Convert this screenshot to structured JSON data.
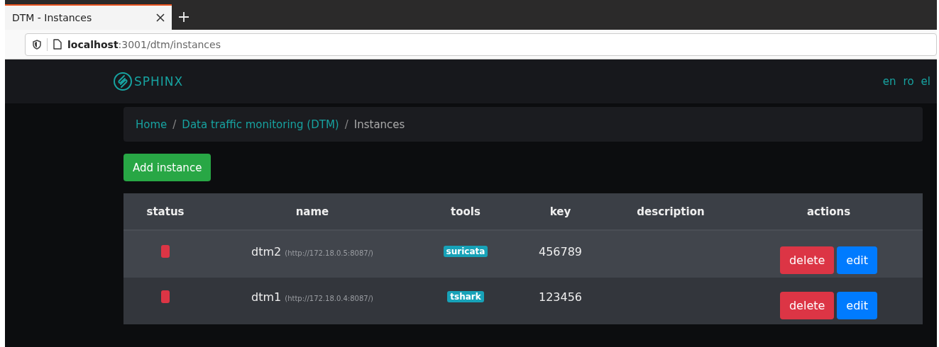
{
  "browser": {
    "tab_title": "DTM - Instances",
    "url_host": "localhost",
    "url_path": ":3001/dtm/instances"
  },
  "navbar": {
    "brand": "SPHINX",
    "languages": [
      "en",
      "ro",
      "el"
    ]
  },
  "breadcrumb": [
    {
      "kind": "link",
      "label": "Home"
    },
    {
      "kind": "separator",
      "label": "/"
    },
    {
      "kind": "link",
      "label": "Data traffic monitoring (DTM)"
    },
    {
      "kind": "separator",
      "label": "/"
    },
    {
      "kind": "current",
      "label": "Instances"
    }
  ],
  "add_button": "Add instance",
  "table": {
    "columns": [
      "status",
      "name",
      "tools",
      "key",
      "description",
      "actions"
    ],
    "rows": [
      {
        "color": "#dc3545",
        "name": "dtm2",
        "url": "(http://172.18.0.5:8087/)",
        "tool": "suricata",
        "key": "456789",
        "actions": [
          "delete",
          "edit"
        ]
      },
      {
        "color": "#dc3545",
        "name": "dtm1",
        "url": "(http://172.18.0.4:8087/)",
        "tool": "tshark",
        "key": "123456",
        "actions": [
          "delete",
          "edit"
        ]
      }
    ]
  }
}
